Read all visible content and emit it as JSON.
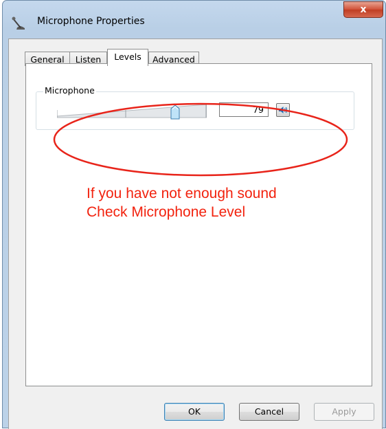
{
  "window": {
    "title": "Microphone Properties",
    "close_glyph": "x"
  },
  "tabs": [
    {
      "label": "General",
      "active": false
    },
    {
      "label": "Listen",
      "active": false
    },
    {
      "label": "Levels",
      "active": true
    },
    {
      "label": "Advanced",
      "active": false
    }
  ],
  "levels": {
    "group_label": "Microphone",
    "value": "79",
    "slider_fraction": 0.79,
    "mute_icon": "speaker-icon"
  },
  "annotation": {
    "line1": "If you have not enough sound",
    "line2": "Check Microphone Level",
    "color": "#f2220e"
  },
  "buttons": {
    "ok": "OK",
    "cancel": "Cancel",
    "apply": "Apply"
  }
}
